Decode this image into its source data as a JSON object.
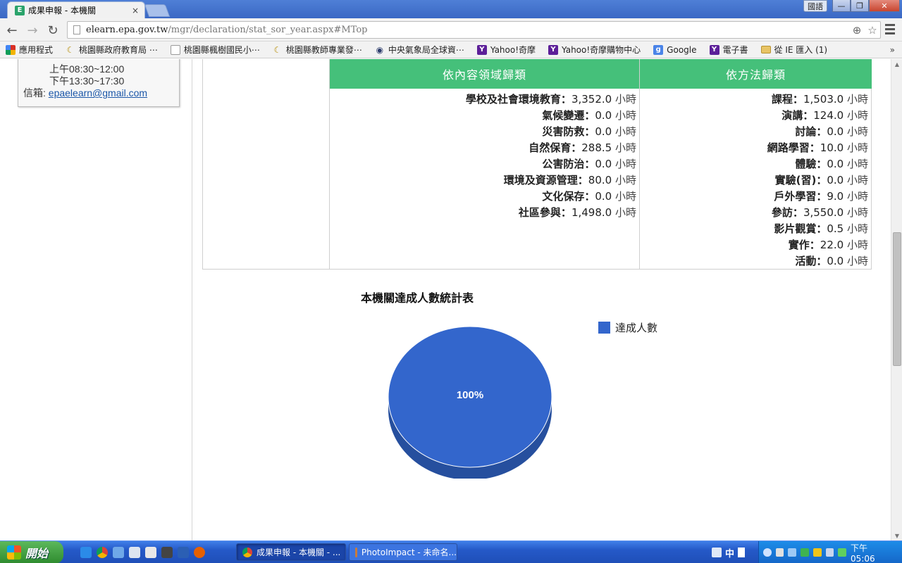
{
  "browser": {
    "tab_title": "成果申報 - 本機關",
    "tab_favicon_letter": "E",
    "tab_close": "×",
    "lang_button": "國語",
    "window_controls": [
      "—",
      "❐",
      "✕"
    ],
    "url_host": "elearn.epa.gov.tw",
    "url_path": "/mgr/declaration/stat_sor_year.aspx#MTop",
    "back": "←",
    "forward": "→",
    "reload": "↻",
    "zoom_icon": "⊕",
    "star_icon": "☆"
  },
  "bookmarks": [
    {
      "label": "應用程式",
      "icon": "apps-icon",
      "kind": "apps"
    },
    {
      "label": "桃園縣政府教育局 ⋯",
      "icon": "moon-icon",
      "kind": "moon"
    },
    {
      "label": "桃園縣楓樹國民小⋯",
      "icon": "page-icon",
      "kind": "page"
    },
    {
      "label": "桃園縣教師專業發⋯",
      "icon": "moon-icon",
      "kind": "moon"
    },
    {
      "label": "中央氣象局全球資⋯",
      "icon": "eye-icon",
      "kind": "eye"
    },
    {
      "label": "Yahoo!奇摩",
      "icon": "yahoo-icon",
      "kind": "yahoo"
    },
    {
      "label": "Yahoo!奇摩購物中心",
      "icon": "yahoo-icon",
      "kind": "yahoo"
    },
    {
      "label": "Google",
      "icon": "google-icon",
      "kind": "g"
    },
    {
      "label": "電子書",
      "icon": "yahoo-icon",
      "kind": "yahoo"
    },
    {
      "label": "從 IE 匯入 (1)",
      "icon": "folder-icon",
      "kind": "folder"
    }
  ],
  "bookmarks_more": "»",
  "contact": {
    "hours_morning": "上午08:30~12:00",
    "hours_afternoon": "下午13:30~17:30",
    "mail_label": "信箱: ",
    "mail_value": "epaelearn@gmail.com"
  },
  "table": {
    "header_domain": "依內容領域歸類",
    "header_method": "依方法歸類",
    "domain_items": [
      {
        "label": "學校及社會環境教育",
        "value": "3,352.0",
        "unit": "小時"
      },
      {
        "label": "氣候變遷",
        "value": "0.0",
        "unit": "小時"
      },
      {
        "label": "災害防救",
        "value": "0.0",
        "unit": "小時"
      },
      {
        "label": "自然保育",
        "value": "288.5",
        "unit": "小時"
      },
      {
        "label": "公害防治",
        "value": "0.0",
        "unit": "小時"
      },
      {
        "label": "環境及資源管理",
        "value": "80.0",
        "unit": "小時"
      },
      {
        "label": "文化保存",
        "value": "0.0",
        "unit": "小時"
      },
      {
        "label": "社區參與",
        "value": "1,498.0",
        "unit": "小時"
      }
    ],
    "method_items": [
      {
        "label": "課程",
        "value": "1,503.0",
        "unit": "小時"
      },
      {
        "label": "演講",
        "value": "124.0",
        "unit": "小時"
      },
      {
        "label": "討論",
        "value": "0.0",
        "unit": "小時"
      },
      {
        "label": "網路學習",
        "value": "10.0",
        "unit": "小時"
      },
      {
        "label": "體驗",
        "value": "0.0",
        "unit": "小時"
      },
      {
        "label": "實驗(習)",
        "value": "0.0",
        "unit": "小時"
      },
      {
        "label": "戶外學習",
        "value": "9.0",
        "unit": "小時"
      },
      {
        "label": "參訪",
        "value": "3,550.0",
        "unit": "小時"
      },
      {
        "label": "影片觀賞",
        "value": "0.5",
        "unit": "小時"
      },
      {
        "label": "實作",
        "value": "22.0",
        "unit": "小時"
      },
      {
        "label": "活動",
        "value": "0.0",
        "unit": "小時"
      }
    ],
    "separator": "："
  },
  "chart_data": {
    "type": "pie",
    "title": "本機關達成人數統計表",
    "slices": [
      {
        "name": "達成人數",
        "value": 100,
        "label": "100%"
      }
    ],
    "legend": [
      "達成人數"
    ],
    "legend_position": "right",
    "colors": {
      "top": "#3366cc",
      "side": "#264f9e"
    }
  },
  "taskbar": {
    "start_label": "開始",
    "tasks": [
      {
        "label": "成果申報 - 本機關 - ...",
        "active": true
      },
      {
        "label": "PhotoImpact - 未命名...",
        "active": false
      }
    ],
    "ime_label": "中",
    "clock": "下午 05:06"
  },
  "scrollbar": {
    "up": "▲",
    "down": "▼"
  }
}
